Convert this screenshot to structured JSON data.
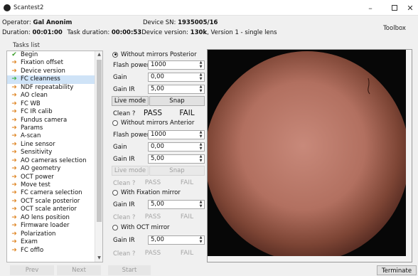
{
  "window": {
    "title": "Scantest2"
  },
  "header": {
    "operator_label": "Operator:",
    "operator_value": "Gal Anonim",
    "device_sn_label": "Device SN:",
    "device_sn_value": "1935005/16",
    "duration_label": "Duration:",
    "duration_value": "00:01:00",
    "task_duration_label": "Task duration:",
    "task_duration_value": "00:00:53",
    "device_version_label": "Device version:",
    "device_version_value": "130k",
    "device_version_suffix": ", Version 1 - single lens",
    "toolbox_label": "Toolbox"
  },
  "tasks": {
    "label": "Tasks list",
    "items": [
      {
        "label": "Begin",
        "icon": "check-icon",
        "state": "done"
      },
      {
        "label": "Fixation offset",
        "icon": "arrow-right-icon",
        "state": "pending"
      },
      {
        "label": "Device version",
        "icon": "arrow-right-icon",
        "state": "pending"
      },
      {
        "label": "FC cleanness",
        "icon": "arrow-right-icon",
        "state": "active"
      },
      {
        "label": "NDF repeatability",
        "icon": "arrow-right-icon",
        "state": "pending"
      },
      {
        "label": "AO clean",
        "icon": "arrow-right-icon",
        "state": "pending"
      },
      {
        "label": "FC WB",
        "icon": "arrow-right-icon",
        "state": "pending"
      },
      {
        "label": "FC IR calib",
        "icon": "arrow-right-icon",
        "state": "pending"
      },
      {
        "label": "Fundus camera",
        "icon": "arrow-right-icon",
        "state": "pending"
      },
      {
        "label": "Params",
        "icon": "arrow-right-icon",
        "state": "pending"
      },
      {
        "label": "A-scan",
        "icon": "arrow-right-icon",
        "state": "pending"
      },
      {
        "label": "Line sensor",
        "icon": "arrow-right-icon",
        "state": "pending"
      },
      {
        "label": "Sensitivity",
        "icon": "arrow-right-icon",
        "state": "pending"
      },
      {
        "label": "AO cameras selection",
        "icon": "arrow-right-icon",
        "state": "pending"
      },
      {
        "label": "AO geometry",
        "icon": "arrow-right-icon",
        "state": "pending"
      },
      {
        "label": "OCT power",
        "icon": "arrow-right-icon",
        "state": "pending"
      },
      {
        "label": "Move test",
        "icon": "arrow-right-icon",
        "state": "pending"
      },
      {
        "label": "FC camera selection",
        "icon": "arrow-right-icon",
        "state": "pending"
      },
      {
        "label": "OCT scale posterior",
        "icon": "arrow-right-icon",
        "state": "pending"
      },
      {
        "label": "OCT scale anterior",
        "icon": "arrow-right-icon",
        "state": "pending"
      },
      {
        "label": "AO lens position",
        "icon": "arrow-right-icon",
        "state": "pending"
      },
      {
        "label": "Firmware loader",
        "icon": "arrow-right-icon",
        "state": "pending"
      },
      {
        "label": "Polarization",
        "icon": "arrow-right-icon",
        "state": "pending"
      },
      {
        "label": "Exam",
        "icon": "arrow-right-icon",
        "state": "pending"
      },
      {
        "label": "FC offlo",
        "icon": "arrow-right-icon",
        "state": "pending"
      }
    ],
    "prev_label": "Prev",
    "next_label": "Next"
  },
  "panel": {
    "sections": [
      {
        "title": "Without mirrors Posterior",
        "selected": true,
        "flash_power_label": "Flash power",
        "flash_power_value": "1000",
        "gain_label": "Gain",
        "gain_value": "0,00",
        "gain_ir_label": "Gain IR",
        "gain_ir_value": "5,00",
        "live_mode_label": "Live mode",
        "snap_label": "Snap",
        "clean_label": "Clean ?",
        "pass_label": "PASS",
        "fail_label": "FAIL"
      },
      {
        "title": "Without mirrors Anterior",
        "selected": false,
        "flash_power_label": "Flash power",
        "flash_power_value": "1000",
        "gain_label": "Gain",
        "gain_value": "0,00",
        "gain_ir_label": "Gain IR",
        "gain_ir_value": "5,00",
        "live_mode_label": "Live mode",
        "snap_label": "Snap",
        "clean_label": "Clean ?",
        "pass_label": "PASS",
        "fail_label": "FAIL"
      },
      {
        "title": "With Fixation mirror",
        "selected": false,
        "gain_ir_label": "Gain IR",
        "gain_ir_value": "5,00",
        "clean_label": "Clean ?",
        "pass_label": "PASS",
        "fail_label": "FAIL"
      },
      {
        "title": "With OCT mirror",
        "selected": false,
        "gain_ir_label": "Gain IR",
        "gain_ir_value": "5,00",
        "clean_label": "Clean ?",
        "pass_label": "PASS",
        "fail_label": "FAIL"
      }
    ]
  },
  "footer": {
    "start_label": "Start",
    "terminate_label": "Terminate"
  },
  "colors": {
    "check": "#3a9d2a",
    "arrow": "#e08a2c",
    "active_row": "#cfe3f7",
    "fundus_center": "#c8897a",
    "fundus_edge": "#5a2e24"
  }
}
